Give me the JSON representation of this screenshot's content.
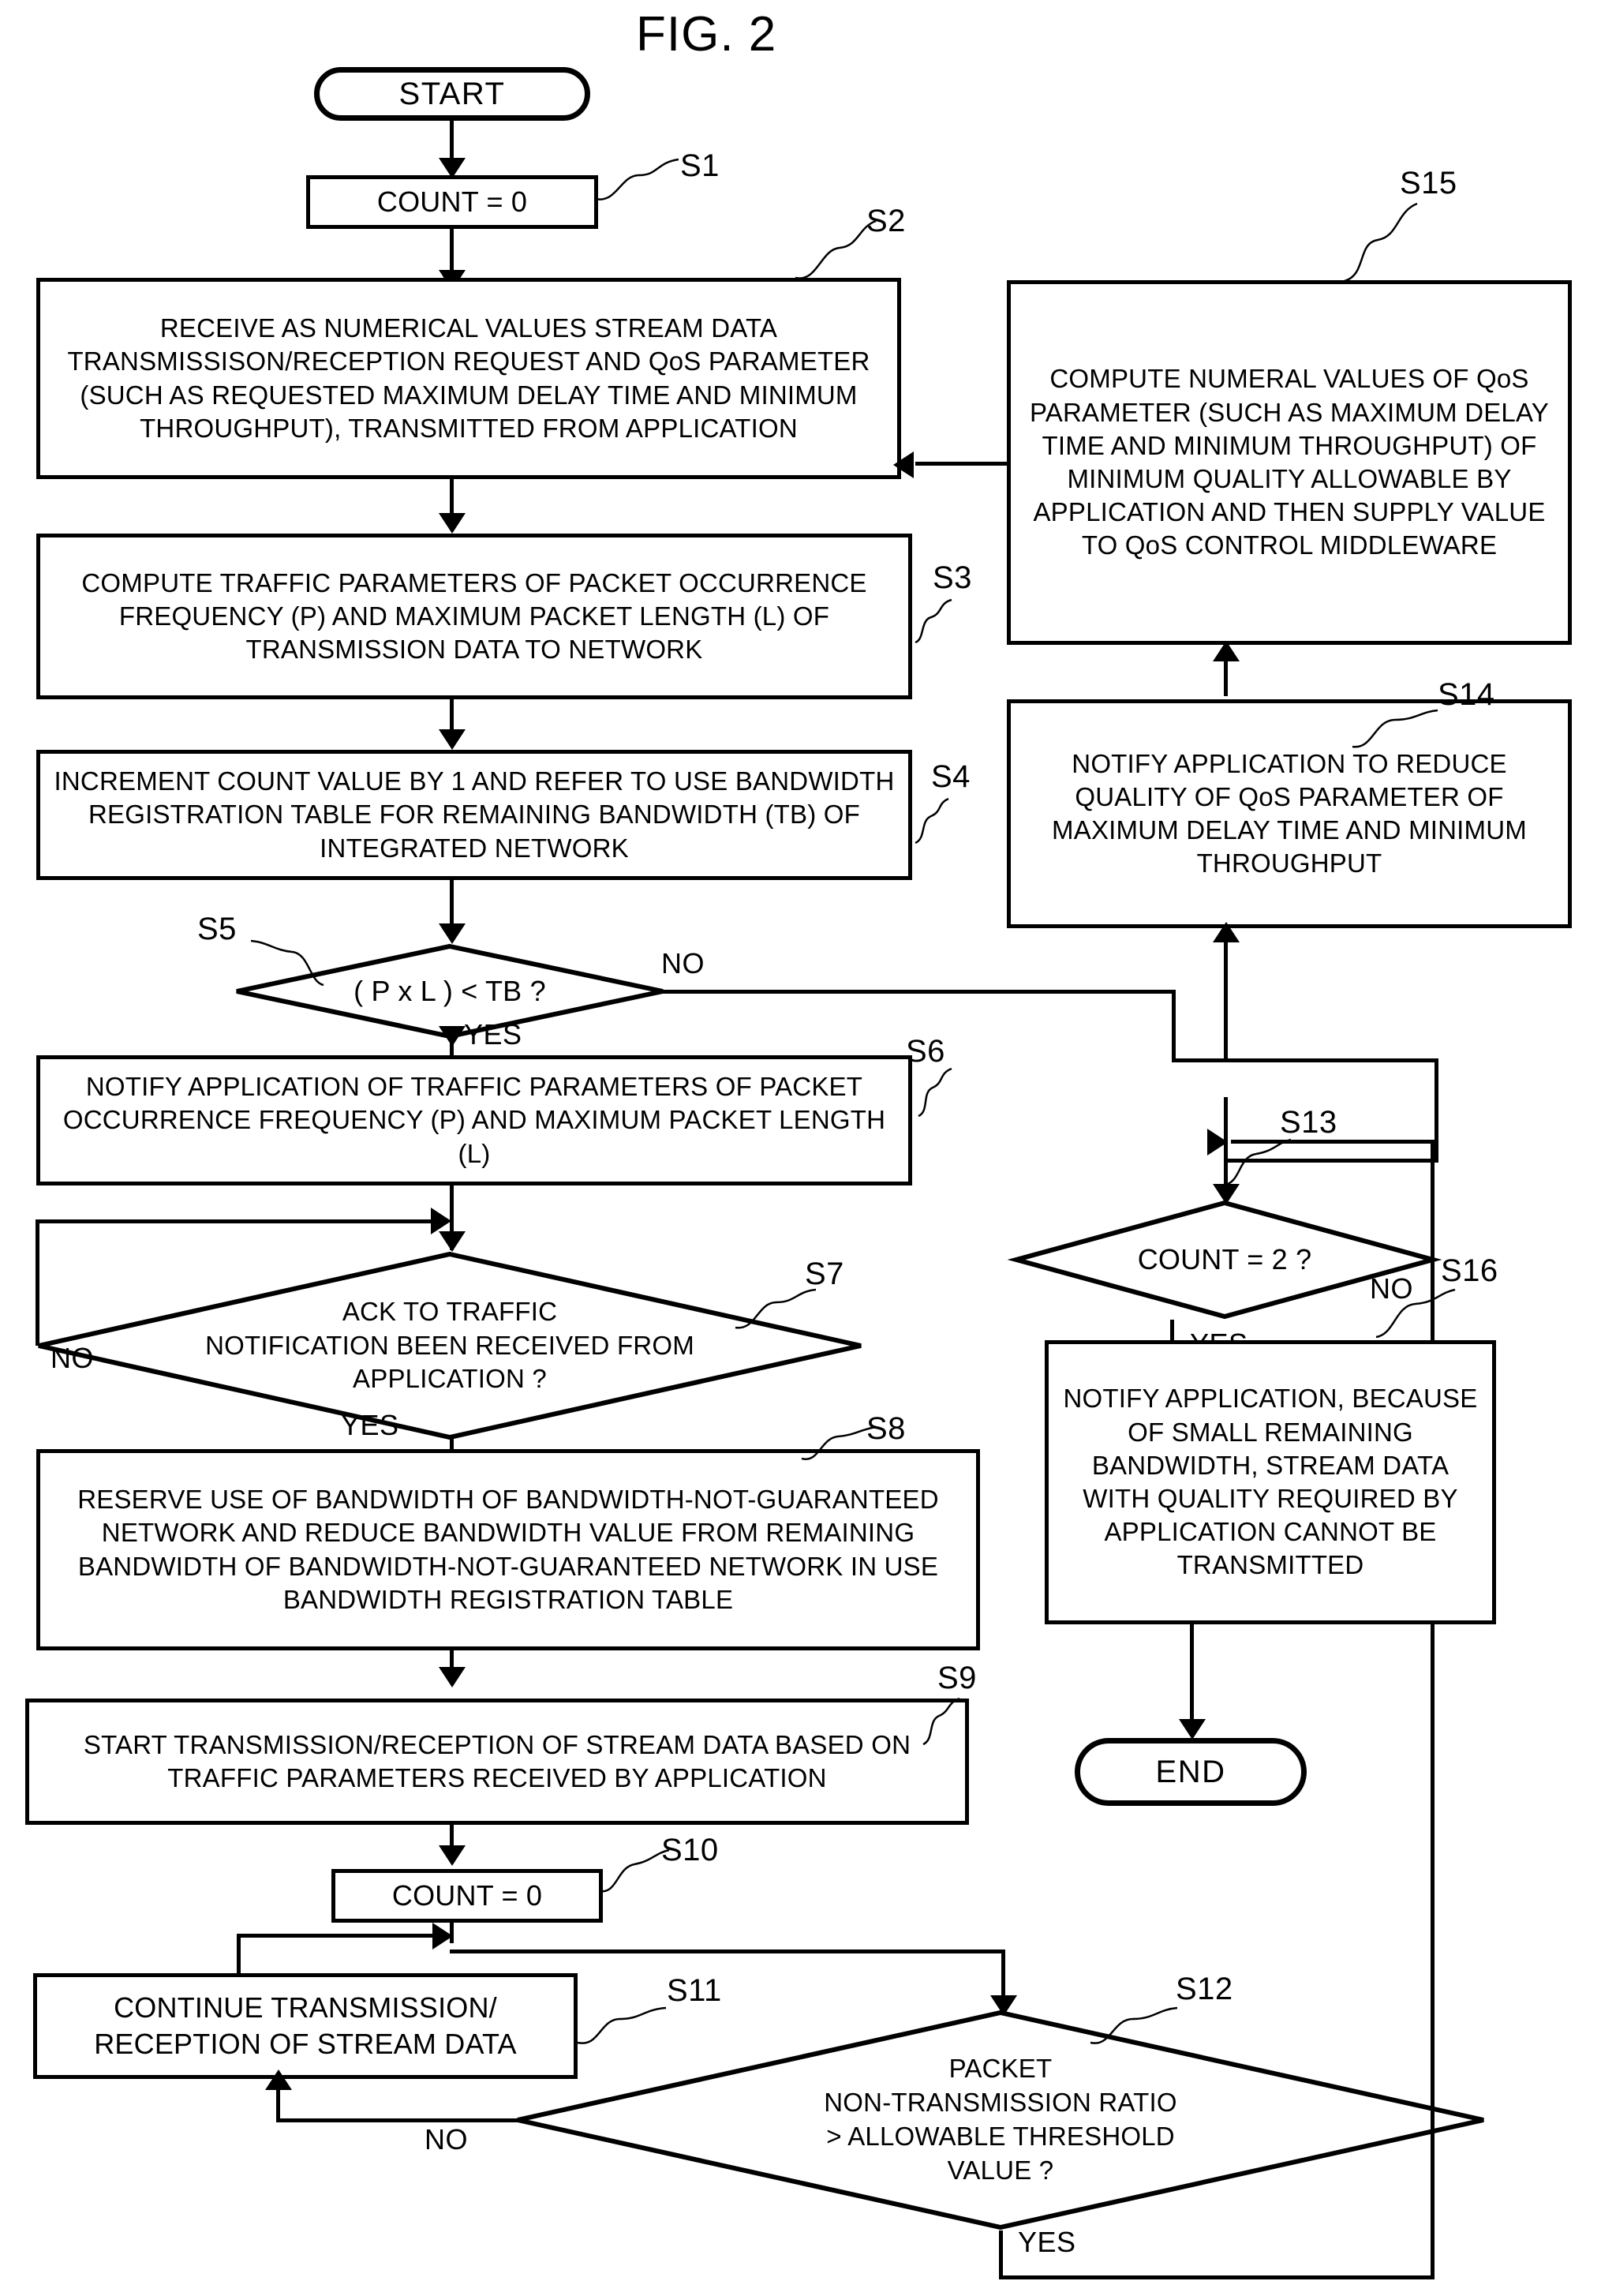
{
  "figure": {
    "title": "FIG. 2"
  },
  "terminals": {
    "start": "START",
    "end": "END"
  },
  "steps": {
    "s1": {
      "ref": "S1",
      "text": "COUNT = 0"
    },
    "s2": {
      "ref": "S2",
      "text": "RECEIVE AS NUMERICAL VALUES STREAM DATA TRANSMISSISON/RECEPTION REQUEST AND QoS PARAMETER (SUCH AS REQUESTED MAXIMUM DELAY TIME AND MINIMUM THROUGHPUT), TRANSMITTED FROM APPLICATION"
    },
    "s3": {
      "ref": "S3",
      "text": "COMPUTE TRAFFIC PARAMETERS OF PACKET OCCURRENCE FREQUENCY (P) AND MAXIMUM PACKET LENGTH (L)  OF TRANSMISSION DATA TO NETWORK"
    },
    "s4": {
      "ref": "S4",
      "text": "INCREMENT COUNT VALUE BY 1 AND REFER TO USE BANDWIDTH REGISTRATION TABLE FOR REMAINING BANDWIDTH (TB) OF INTEGRATED NETWORK"
    },
    "s5": {
      "ref": "S5",
      "text": "( P x L ) < TB ?",
      "yes": "YES",
      "no": "NO"
    },
    "s6": {
      "ref": "S6",
      "text": "NOTIFY APPLICATION OF TRAFFIC PARAMETERS OF PACKET OCCURRENCE FREQUENCY (P) AND MAXIMUM PACKET LENGTH (L)"
    },
    "s7": {
      "ref": "S7",
      "text": "ACK TO TRAFFIC\nNOTIFICATION BEEN RECEIVED FROM\nAPPLICATION ?",
      "yes": "YES",
      "no": "NO"
    },
    "s8": {
      "ref": "S8",
      "text": "RESERVE USE OF BANDWIDTH OF BANDWIDTH-NOT-GUARANTEED NETWORK AND REDUCE  BANDWIDTH VALUE FROM REMAINING BANDWIDTH OF BANDWIDTH-NOT-GUARANTEED NETWORK IN USE BANDWIDTH REGISTRATION TABLE"
    },
    "s9": {
      "ref": "S9",
      "text": "START TRANSMISSION/RECEPTION OF STREAM DATA BASED ON TRAFFIC PARAMETERS RECEIVED BY APPLICATION"
    },
    "s10": {
      "ref": "S10",
      "text": "COUNT = 0"
    },
    "s11": {
      "ref": "S11",
      "text": "CONTINUE TRANSMISSION/ RECEPTION OF STREAM DATA"
    },
    "s12": {
      "ref": "S12",
      "text": "PACKET\nNON-TRANSMISSION RATIO\n> ALLOWABLE THRESHOLD\nVALUE ?",
      "yes": "YES",
      "no": "NO"
    },
    "s13": {
      "ref": "S13",
      "text": "COUNT = 2 ?",
      "yes": "YES",
      "no": "NO"
    },
    "s14": {
      "ref": "S14",
      "text": "NOTIFY APPLICATION TO REDUCE QUALITY OF QoS PARAMETER OF MAXIMUM DELAY TIME AND MINIMUM THROUGHPUT"
    },
    "s15": {
      "ref": "S15",
      "text": "COMPUTE NUMERAL VALUES OF QoS PARAMETER (SUCH AS MAXIMUM DELAY TIME AND MINIMUM THROUGHPUT) OF MINIMUM QUALITY ALLOWABLE BY APPLICATION AND THEN SUPPLY VALUE TO QoS CONTROL MIDDLEWARE"
    },
    "s16": {
      "ref": "S16",
      "text": "NOTIFY APPLICATION, BECAUSE OF SMALL REMAINING BANDWIDTH, STREAM DATA WITH QUALITY REQUIRED BY APPLICATION CANNOT BE TRANSMITTED"
    }
  },
  "colors": {
    "ink": "#000000",
    "paper": "#ffffff"
  }
}
